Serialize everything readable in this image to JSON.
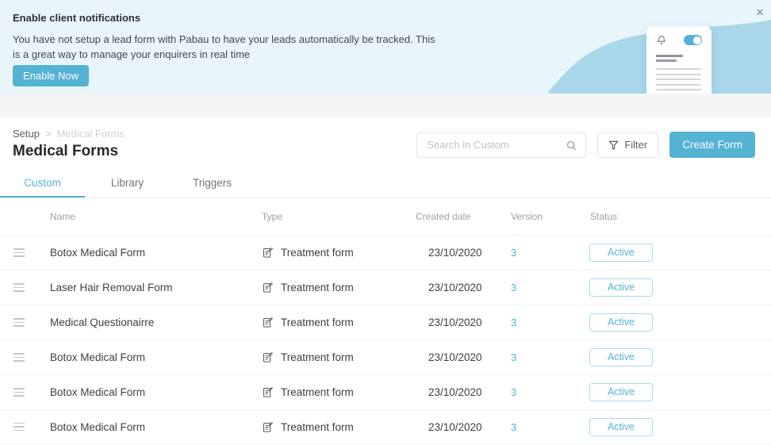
{
  "colors": {
    "accent": "#54b2d3",
    "banner_bg": "#e8f6fb",
    "wave": "#a9d6e8",
    "badge_border": "#a5dbeb"
  },
  "banner": {
    "title": "Enable client notifications",
    "body_lines": [
      "You have not setup a lead form with Pabau to have your leads automatically be tracked. This",
      "is a great way to manage your enquirers in real time"
    ],
    "cta": "Enable Now",
    "close_icon": "×"
  },
  "breadcrumb": {
    "root": "Setup",
    "separator": ">",
    "current": "Medical Forms"
  },
  "page": {
    "title": "Medical Forms"
  },
  "toolbar": {
    "search_placeholder": "Search in Custom",
    "filter_label": "Filter",
    "create_label": "Create Form"
  },
  "tabs": [
    {
      "label": "Custom",
      "active": true
    },
    {
      "label": "Library",
      "active": false
    },
    {
      "label": "Triggers",
      "active": false
    }
  ],
  "table": {
    "columns": [
      "Name",
      "Type",
      "Created date",
      "Version",
      "Status"
    ],
    "rows": [
      {
        "name": "Botox Medical Form",
        "type": "Treatment form",
        "created": "23/10/2020",
        "version": "3",
        "status": "Active"
      },
      {
        "name": "Laser Hair Removal Form",
        "type": "Treatment form",
        "created": "23/10/2020",
        "version": "3",
        "status": "Active"
      },
      {
        "name": "Medical Questionairre",
        "type": "Treatment form",
        "created": "23/10/2020",
        "version": "3",
        "status": "Active"
      },
      {
        "name": "Botox Medical Form",
        "type": "Treatment form",
        "created": "23/10/2020",
        "version": "3",
        "status": "Active"
      },
      {
        "name": "Botox Medical Form",
        "type": "Treatment form",
        "created": "23/10/2020",
        "version": "3",
        "status": "Active"
      },
      {
        "name": "Botox Medical Form",
        "type": "Treatment form",
        "created": "23/10/2020",
        "version": "3",
        "status": "Active"
      }
    ]
  },
  "icons": {
    "close": "close-icon",
    "bell": "bell-icon",
    "toggle": "notifications-toggle",
    "search": "search-icon",
    "filter": "funnel-icon",
    "drag": "drag-handle-icon",
    "type": "treatment-form-icon"
  }
}
